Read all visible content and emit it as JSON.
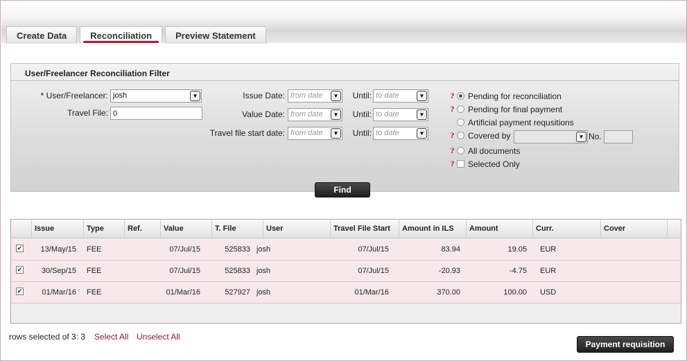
{
  "tabs": [
    {
      "label": "Create Data",
      "active": false
    },
    {
      "label": "Reconciliation",
      "active": true
    },
    {
      "label": "Preview Statement",
      "active": false
    }
  ],
  "filter": {
    "title": "User/Freelancer Reconciliation Filter",
    "user_label": "* User/Freelancer:",
    "user_value": "josh",
    "travel_file_label": "Travel File:",
    "travel_file_value": "0",
    "issue_date_label": "Issue Date:",
    "value_date_label": "Value Date:",
    "tf_start_label": "Travel file start date:",
    "until_label": "Until:",
    "from_placeholder": "from date",
    "to_placeholder": "to date",
    "radios": [
      {
        "label": "Pending for reconciliation",
        "checked": true,
        "help": true
      },
      {
        "label": "Pending for final payment",
        "checked": false,
        "help": true
      },
      {
        "label": "Artificial payment requsitions",
        "checked": false,
        "help": false
      },
      {
        "label": "Covered by",
        "checked": false,
        "help": true
      },
      {
        "label": "All documents",
        "checked": false,
        "help": true
      }
    ],
    "selected_only_label": "Selected Only",
    "no_label": "No.",
    "find_label": "Find",
    "help_glyph": "?"
  },
  "table": {
    "columns": [
      "Issue",
      "Type",
      "Ref.",
      "Value",
      "T. File",
      "User",
      "Travel File Start",
      "Amount in ILS",
      "Amount",
      "Curr.",
      "Cover"
    ],
    "rows": [
      {
        "checked": true,
        "issue": "13/May/15",
        "type": "FEE",
        "ref": "",
        "value": "07/Jul/15",
        "tfile": "525833",
        "user": "josh",
        "tf_start": "07/Jul/15",
        "amount_ils": "83.94",
        "amount": "19.05",
        "curr": "EUR",
        "cover": ""
      },
      {
        "checked": true,
        "issue": "30/Sep/15",
        "type": "FEE",
        "ref": "",
        "value": "07/Jul/15",
        "tfile": "525833",
        "user": "josh",
        "tf_start": "07/Jul/15",
        "amount_ils": "-20.93",
        "amount": "-4.75",
        "curr": "EUR",
        "cover": ""
      },
      {
        "checked": true,
        "issue": "01/Mar/16",
        "type": "FEE",
        "ref": "",
        "value": "01/Mar/16",
        "tfile": "527927",
        "user": "josh",
        "tf_start": "01/Mar/16",
        "amount_ils": "370.00",
        "amount": "100.00",
        "curr": "USD",
        "cover": ""
      }
    ]
  },
  "footer": {
    "rows_selected_text": "rows selected of 3:",
    "rows_selected_count": "3",
    "select_all": "Select All",
    "unselect_all": "Unselect All",
    "payment_button": "Payment requisition"
  },
  "colors": {
    "accent": "#c8102e",
    "row_bg": "#f7e9ea",
    "link": "#8b1b2f",
    "button": "#222222"
  },
  "icons": {
    "dropdown": "chevron-down-icon",
    "help": "question-mark-icon",
    "check": "checkmark-icon"
  }
}
